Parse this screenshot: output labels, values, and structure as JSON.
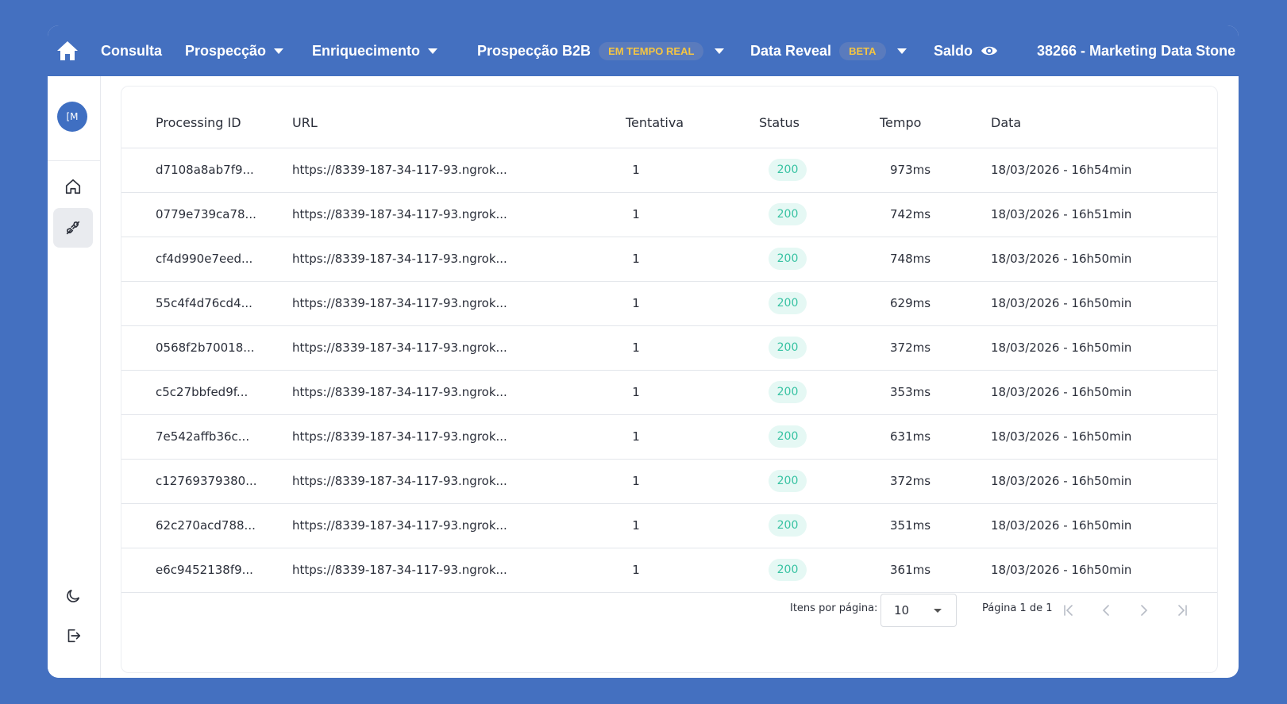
{
  "nav": {
    "items": [
      {
        "label": "Consulta"
      },
      {
        "label": "Prospecção"
      },
      {
        "label": "Enriquecimento"
      },
      {
        "label": "Prospecção B2B",
        "badge": "EM TEMPO REAL"
      },
      {
        "label": "Data Reveal",
        "badge": "BETA"
      },
      {
        "label": "Saldo"
      }
    ],
    "account": "38266 - Marketing Data Stone"
  },
  "sidebar": {
    "avatar_text": "[M"
  },
  "table": {
    "headers": [
      "Processing ID",
      "URL",
      "Tentativa",
      "Status",
      "Tempo",
      "Data"
    ],
    "rows": [
      {
        "id": "d7108a8ab7f9...",
        "url": "https://8339-187-34-117-93.ngrok...",
        "tentativa": "1",
        "status": "200",
        "tempo": "973ms",
        "data": "18/03/2026 - 16h54min"
      },
      {
        "id": "0779e739ca78...",
        "url": "https://8339-187-34-117-93.ngrok...",
        "tentativa": "1",
        "status": "200",
        "tempo": "742ms",
        "data": "18/03/2026 - 16h51min"
      },
      {
        "id": "cf4d990e7eed...",
        "url": "https://8339-187-34-117-93.ngrok...",
        "tentativa": "1",
        "status": "200",
        "tempo": "748ms",
        "data": "18/03/2026 - 16h50min"
      },
      {
        "id": "55c4f4d76cd4...",
        "url": "https://8339-187-34-117-93.ngrok...",
        "tentativa": "1",
        "status": "200",
        "tempo": "629ms",
        "data": "18/03/2026 - 16h50min"
      },
      {
        "id": "0568f2b70018...",
        "url": "https://8339-187-34-117-93.ngrok...",
        "tentativa": "1",
        "status": "200",
        "tempo": "372ms",
        "data": "18/03/2026 - 16h50min"
      },
      {
        "id": "c5c27bbfed9f...",
        "url": "https://8339-187-34-117-93.ngrok...",
        "tentativa": "1",
        "status": "200",
        "tempo": "353ms",
        "data": "18/03/2026 - 16h50min"
      },
      {
        "id": "7e542affb36c...",
        "url": "https://8339-187-34-117-93.ngrok...",
        "tentativa": "1",
        "status": "200",
        "tempo": "631ms",
        "data": "18/03/2026 - 16h50min"
      },
      {
        "id": "c12769379380...",
        "url": "https://8339-187-34-117-93.ngrok...",
        "tentativa": "1",
        "status": "200",
        "tempo": "372ms",
        "data": "18/03/2026 - 16h50min"
      },
      {
        "id": "62c270acd788...",
        "url": "https://8339-187-34-117-93.ngrok...",
        "tentativa": "1",
        "status": "200",
        "tempo": "351ms",
        "data": "18/03/2026 - 16h50min"
      },
      {
        "id": "e6c9452138f9...",
        "url": "https://8339-187-34-117-93.ngrok...",
        "tentativa": "1",
        "status": "200",
        "tempo": "361ms",
        "data": "18/03/2026 - 16h50min"
      }
    ]
  },
  "pagination": {
    "items_label": "Itens por página:",
    "items_value": "10",
    "page_info": "Página 1 de 1"
  },
  "colors": {
    "brand": "#4470c0",
    "badge_bg": "#e5f8f4",
    "badge_text": "#39c3a3",
    "beta_text": "#f5c542"
  },
  "icons": [
    "home-icon",
    "plug-icon",
    "moon-icon",
    "logout-icon",
    "eye-icon",
    "first-page-icon",
    "prev-page-icon",
    "next-page-icon",
    "last-page-icon"
  ]
}
